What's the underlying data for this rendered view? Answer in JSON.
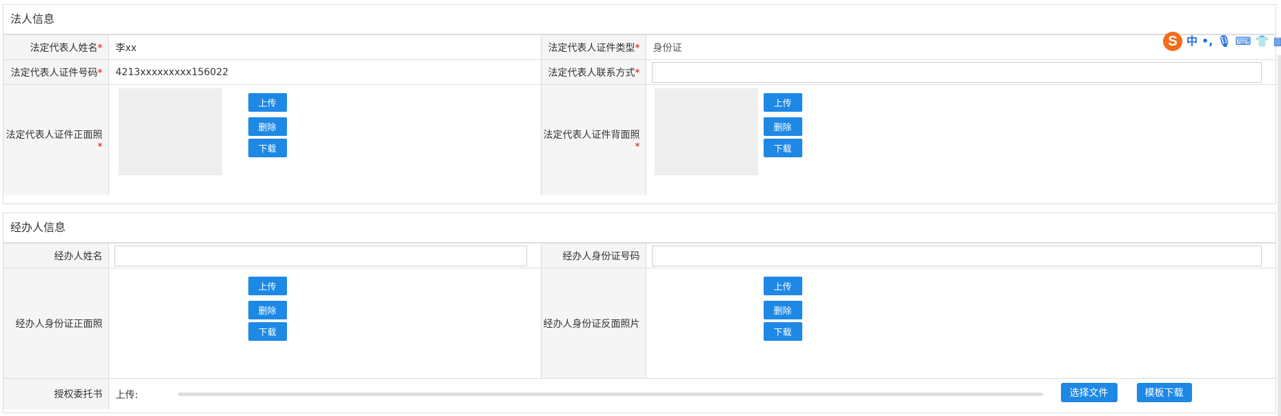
{
  "legal": {
    "title": "法人信息",
    "name_label": "法定代表人姓名",
    "name_value": "李xx",
    "id_type_label": "法定代表人证件类型",
    "id_type_value": "身份证",
    "id_no_label": "法定代表人证件号码",
    "id_no_value": "4213xxxxxxxxx156022",
    "contact_label": "法定代表人联系方式",
    "contact_value": "",
    "front_label": "法定代表人证件正面照",
    "back_label": "法定代表人证件背面照"
  },
  "agent": {
    "title": "经办人信息",
    "name_label": "经办人姓名",
    "id_no_label": "经办人身份证号码",
    "front_label": "经办人身份证正面照",
    "back_label": "经办人身份证反面照片",
    "auth_label": "授权委托书",
    "upload_label": "上传:",
    "choose_file": "选择文件",
    "template_download": "模板下载"
  },
  "buttons": {
    "upload": "上传",
    "delete": "删除",
    "download": "下载"
  },
  "required_mark": "*",
  "ime": {
    "logo": "S",
    "lang": "中",
    "punct": "•,",
    "mic": "🎙",
    "keyboard": "⌨",
    "skin": "👕",
    "apps": "▦"
  }
}
